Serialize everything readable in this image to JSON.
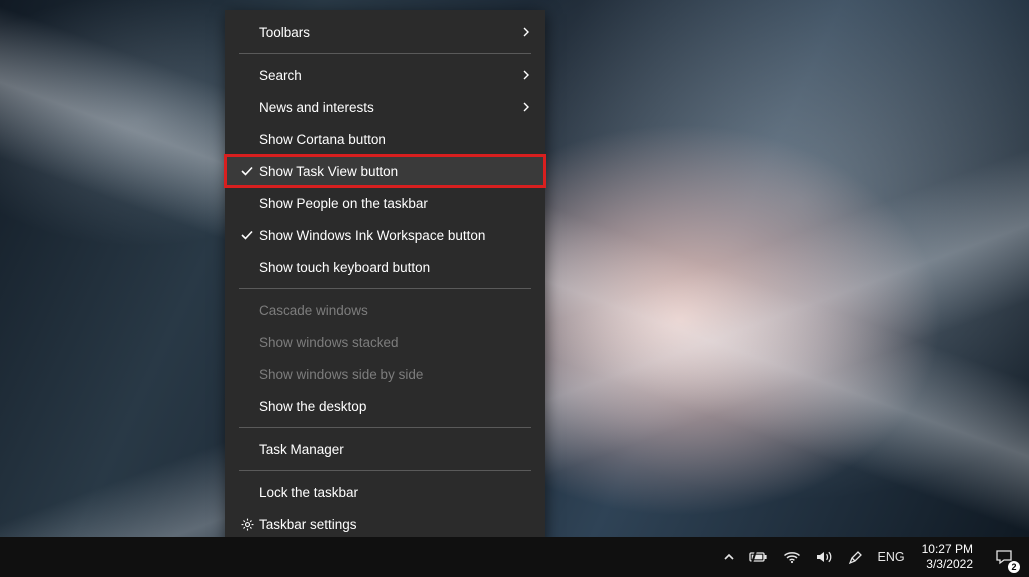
{
  "contextMenu": {
    "items": [
      {
        "label": "Toolbars",
        "hasSubmenu": true
      },
      {
        "label": "Search",
        "hasSubmenu": true
      },
      {
        "label": "News and interests",
        "hasSubmenu": true
      },
      {
        "label": "Show Cortana button"
      },
      {
        "label": "Show Task View button",
        "checked": true,
        "highlighted": true
      },
      {
        "label": "Show People on the taskbar"
      },
      {
        "label": "Show Windows Ink Workspace button",
        "checked": true
      },
      {
        "label": "Show touch keyboard button"
      },
      {
        "label": "Cascade windows",
        "disabled": true
      },
      {
        "label": "Show windows stacked",
        "disabled": true
      },
      {
        "label": "Show windows side by side",
        "disabled": true
      },
      {
        "label": "Show the desktop"
      },
      {
        "label": "Task Manager"
      },
      {
        "label": "Lock the taskbar"
      },
      {
        "label": "Taskbar settings",
        "icon": "gear"
      }
    ]
  },
  "taskbar": {
    "language": "ENG",
    "time": "10:27 PM",
    "date": "3/3/2022",
    "notificationCount": "2"
  }
}
